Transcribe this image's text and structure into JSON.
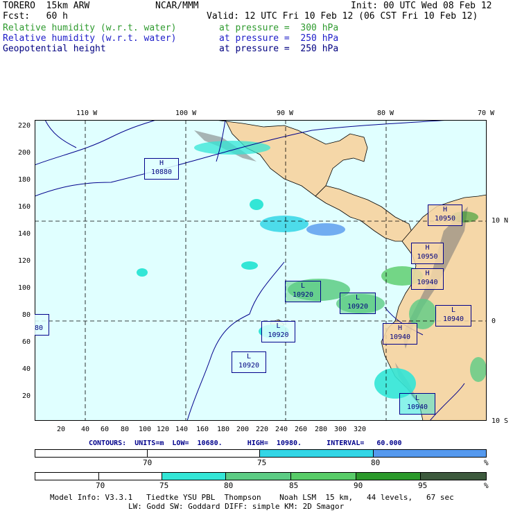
{
  "header": {
    "model": "TORERO  15km ARW",
    "center": "NCAR/MMM",
    "init": "Init: 00 UTC Wed 08 Feb 12",
    "fcst": "Fcst:   60 h",
    "valid": "Valid: 12 UTC Fri 10 Feb 12 (06 CST Fri 10 Feb 12)",
    "fields": [
      {
        "name": "Relative humidity (w.r.t. water)",
        "level": "at pressure =  300 hPa",
        "color": "#2e9a2e"
      },
      {
        "name": "Relative humidity (w.r.t. water)",
        "level": "at pressure =  250 hPa",
        "color": "#1c1cc8"
      },
      {
        "name": "Geopotential height",
        "level": "at pressure =  250 hPa",
        "color": "#000080"
      }
    ]
  },
  "map": {
    "top_lon_labels": [
      "110 W",
      "100 W",
      "90 W",
      "80 W",
      "70 W"
    ],
    "right_lat_labels": [
      "10 N",
      "0",
      "10 S"
    ],
    "y_ticks": [
      "220",
      "200",
      "180",
      "160",
      "140",
      "120",
      "100",
      "80",
      "60",
      "40",
      "20"
    ],
    "x_ticks": [
      "20",
      "40",
      "60",
      "80",
      "100",
      "120",
      "140",
      "160",
      "180",
      "200",
      "220",
      "240",
      "260",
      "280",
      "300",
      "320"
    ],
    "ocean_color": "#e0ffff",
    "land_color": "#f5d7a8",
    "centers": [
      {
        "type": "H",
        "value": "10880"
      },
      {
        "type": "H",
        "value": "10950"
      },
      {
        "type": "H",
        "value": "10950"
      },
      {
        "type": "H",
        "value": "10940"
      },
      {
        "type": "L",
        "value": "10920"
      },
      {
        "type": "L",
        "value": "10920"
      },
      {
        "type": "L",
        "value": "10920"
      },
      {
        "type": "L",
        "value": "10920"
      },
      {
        "type": "L",
        "value": "10940"
      },
      {
        "type": "H",
        "value": "10940"
      },
      {
        "type": "L",
        "value": "10940"
      },
      {
        "type": "",
        "value": "80"
      }
    ]
  },
  "contours": {
    "text": "CONTOURS:  UNITS=m  LOW=  10680.      HIGH=  10980.      INTERVAL=   60.000"
  },
  "colorbar1": {
    "labels": [
      "70",
      "75",
      "80",
      "%"
    ],
    "colors": [
      "#ffffff",
      "#ffffff",
      "#33d6e6",
      "#5599ee"
    ]
  },
  "colorbar2": {
    "labels": [
      "70",
      "75",
      "80",
      "85",
      "90",
      "95",
      "%"
    ],
    "colors": [
      "#ffffff",
      "#ffffff",
      "#ffffff",
      "#33e6d6",
      "#5ccc84",
      "#58cc68",
      "#2b992b",
      "#3d5a3d"
    ]
  },
  "footer": {
    "line1": "Model Info: V3.3.1   Tiedtke YSU PBL  Thompson    Noah LSM  15 km,   44 levels,   67 sec",
    "line2": "LW: Godd SW: Goddard DIFF: simple KM: 2D Smagor"
  }
}
